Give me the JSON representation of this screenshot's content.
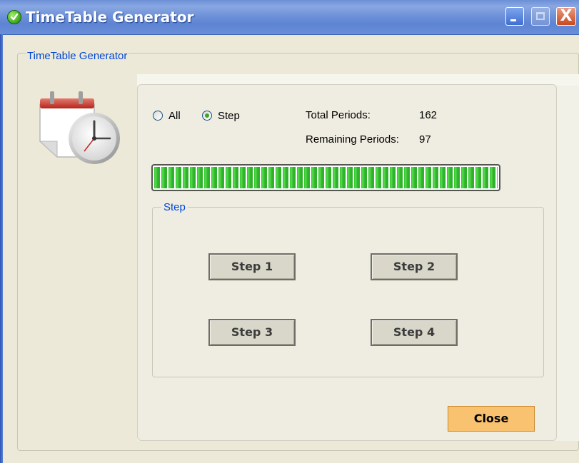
{
  "window": {
    "title": "TimeTable Generator",
    "icon": "green-check-icon",
    "controls": [
      "minimize-icon",
      "maximize-icon",
      "close-icon"
    ],
    "close_glyph": "X"
  },
  "group": {
    "label": "TimeTable Generator"
  },
  "illustration": "calendar-clock-icon",
  "mode": {
    "options": [
      {
        "label": "All",
        "selected": false
      },
      {
        "label": "Step",
        "selected": true
      }
    ]
  },
  "stats": {
    "total_label": "Total Periods:",
    "total_value": "162",
    "remaining_label": "Remaining Periods:",
    "remaining_value": "97"
  },
  "progress": {
    "fraction": 1.0,
    "color": "#33c22f"
  },
  "step_group": {
    "label": "Step",
    "buttons": [
      "Step 1",
      "Step 2",
      "Step 3",
      "Step 4"
    ]
  },
  "close_button": {
    "label": "Close",
    "color": "#f8c270"
  },
  "colors": {
    "title_bar": "#6f93da",
    "accent_label": "#0046d5"
  }
}
